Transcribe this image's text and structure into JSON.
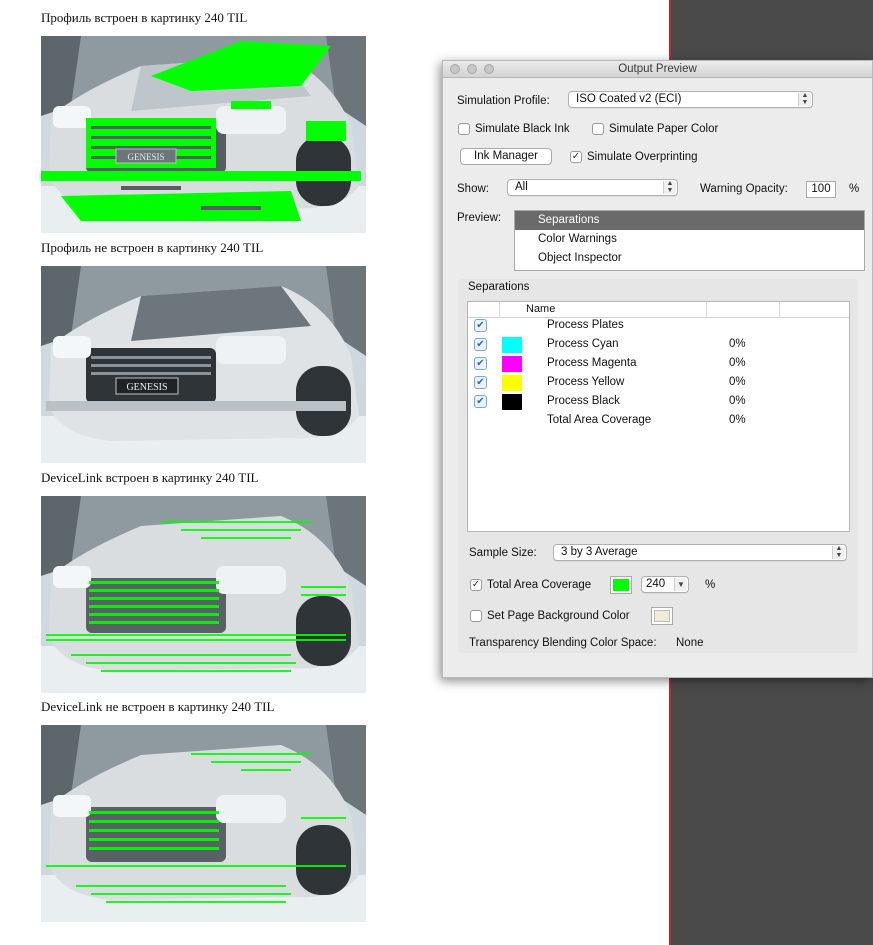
{
  "document": {
    "captions": [
      "Профиль встроен в картинку 240 TIL",
      "Профиль не встроен в картинку 240 TIL",
      "DeviceLink встроен в картинку 240 TIL",
      "DeviceLink не встроен в картинку 240 TIL"
    ],
    "car_badge": "GENESIS"
  },
  "panel": {
    "title": "Output Preview",
    "simulation_profile_label": "Simulation Profile:",
    "simulation_profile_value": "ISO Coated v2 (ECI)",
    "simulate_black_ink": "Simulate Black Ink",
    "simulate_paper_color": "Simulate Paper Color",
    "ink_manager": "Ink Manager",
    "simulate_overprinting": "Simulate Overprinting",
    "show_label": "Show:",
    "show_value": "All",
    "warning_opacity_label": "Warning Opacity:",
    "warning_opacity_value": "100",
    "percent": "%",
    "preview_label": "Preview:",
    "preview_items": [
      "Separations",
      "Color Warnings",
      "Object Inspector"
    ],
    "separations_title": "Separations",
    "name_header": "Name",
    "rows": [
      {
        "name": "Process Plates",
        "pct": "",
        "color": ""
      },
      {
        "name": "Process Cyan",
        "pct": "0%",
        "color": "#00ffff"
      },
      {
        "name": "Process Magenta",
        "pct": "0%",
        "color": "#ff00ff"
      },
      {
        "name": "Process Yellow",
        "pct": "0%",
        "color": "#ffff00"
      },
      {
        "name": "Process Black",
        "pct": "0%",
        "color": "#000000"
      },
      {
        "name": "Total Area Coverage",
        "pct": "0%",
        "color": ""
      }
    ],
    "sample_size_label": "Sample Size:",
    "sample_size_value": "3 by 3 Average",
    "total_area_coverage": "Total Area Coverage",
    "tac_value": "240",
    "tac_swatch": "#00ff00",
    "set_page_bg": "Set Page Background Color",
    "page_bg_swatch": "#f0ecd8",
    "blending_label": "Transparency Blending Color Space:",
    "blending_value": "None"
  }
}
